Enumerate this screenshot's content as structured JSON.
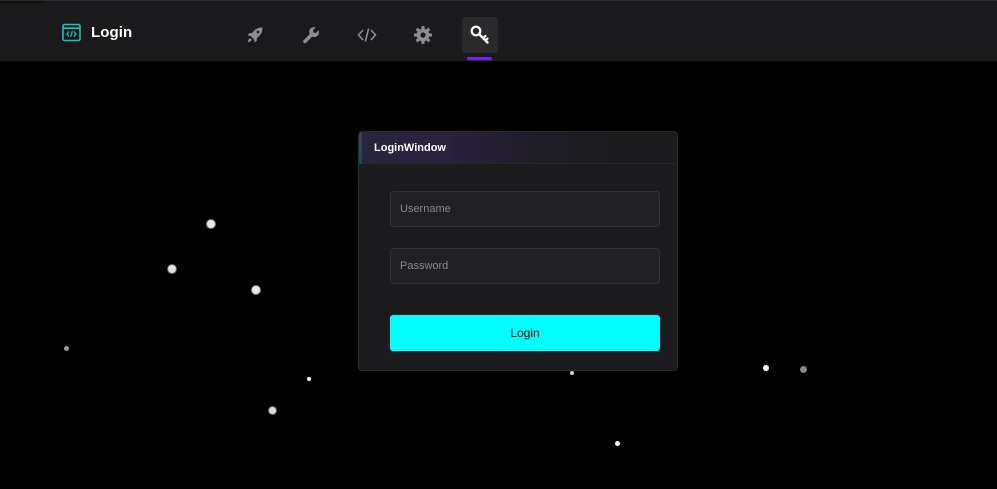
{
  "app": {
    "title": "Login",
    "logo_icon": "code-window-icon",
    "accent_color": "#00ffff",
    "indicator_color": "#7b1fff"
  },
  "nav": {
    "items": [
      {
        "icon": "rocket-icon",
        "active": false
      },
      {
        "icon": "wrench-icon",
        "active": false
      },
      {
        "icon": "code-icon",
        "active": false
      },
      {
        "icon": "gear-icon",
        "active": false
      },
      {
        "icon": "key-icon",
        "active": true
      }
    ]
  },
  "login_window": {
    "title": "LoginWindow",
    "username_placeholder": "Username",
    "password_placeholder": "Password",
    "submit_label": "Login"
  }
}
